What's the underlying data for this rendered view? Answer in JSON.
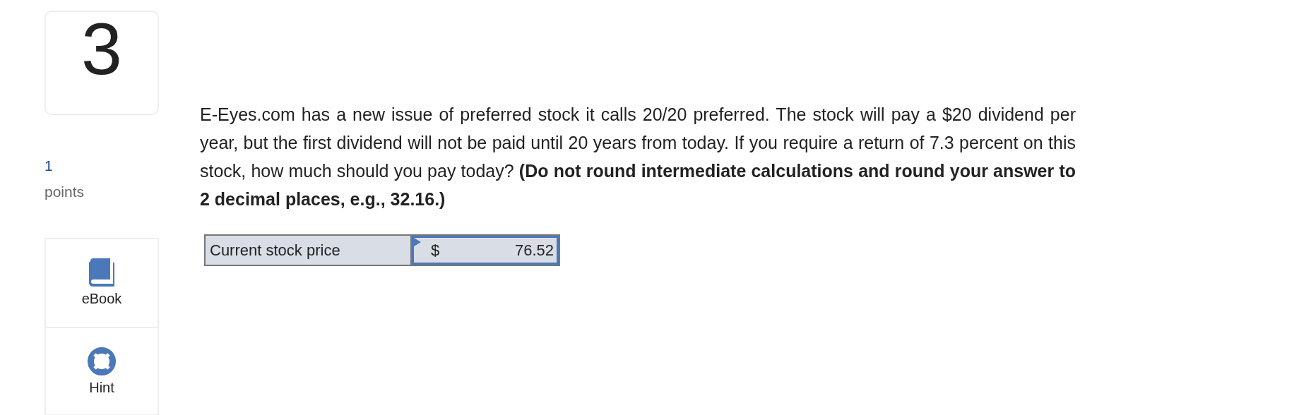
{
  "question_number": "3",
  "points": {
    "value": "1",
    "label": "points"
  },
  "question_text": "E-Eyes.com has a new issue of preferred stock it calls 20/20 preferred. The stock will pay a $20 dividend per year, but the first dividend will not be paid until 20 years from today. If you require a return of 7.3 percent on this stock, how much should you pay today? **(Do not round intermediate calculations and round your answer to 2 decimal places, e.g., 32.16.)**",
  "answer_table": {
    "label": "Current stock price",
    "currency": "$",
    "value": "76.52"
  },
  "tools": [
    {
      "kind": "ebook",
      "label": "eBook"
    },
    {
      "kind": "hint",
      "label": "Hint"
    }
  ]
}
